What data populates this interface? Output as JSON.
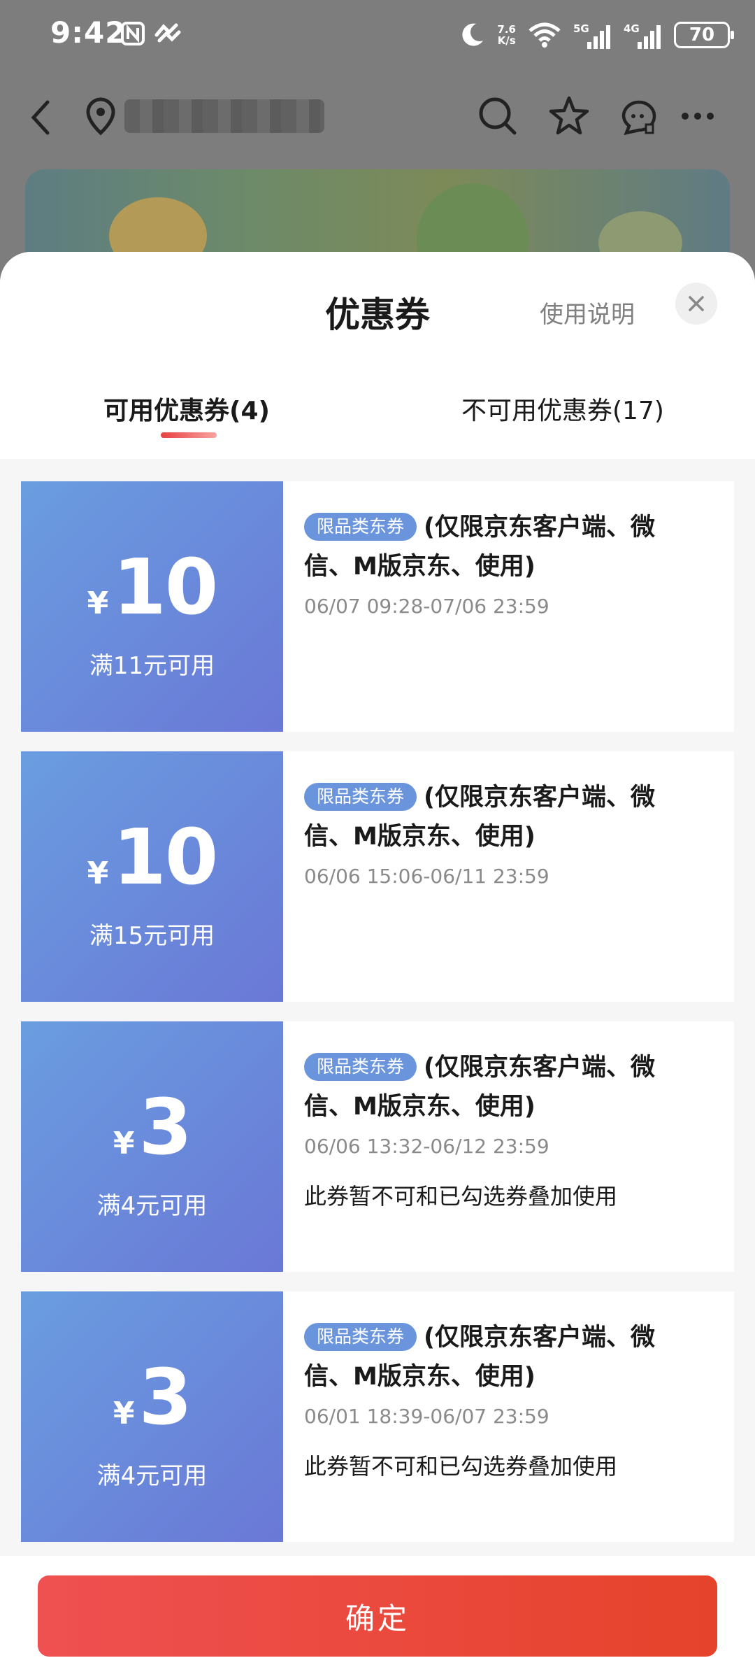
{
  "status_bar": {
    "time": "9:42",
    "net_speed_value": "7.6",
    "net_speed_unit": "K/s",
    "wifi_sub": "6",
    "signal_1": "5G",
    "signal_2": "4G",
    "battery": "70"
  },
  "sheet": {
    "title": "优惠券",
    "help_link": "使用说明",
    "tabs": [
      {
        "label": "可用优惠券(4)",
        "active": true
      },
      {
        "label": "不可用优惠券(17)",
        "active": false
      }
    ],
    "coupons": [
      {
        "currency": "¥",
        "amount": "10",
        "condition": "满11元可用",
        "tag": "限品类东券",
        "description": "(仅限京东客户端、微信、M版京东、使用)",
        "validity": "06/07 09:28-07/06 23:59",
        "note": "",
        "selected": true
      },
      {
        "currency": "¥",
        "amount": "10",
        "condition": "满15元可用",
        "tag": "限品类东券",
        "description": "(仅限京东客户端、微信、M版京东、使用)",
        "validity": "06/06 15:06-06/11 23:59",
        "note": "",
        "selected": true
      },
      {
        "currency": "¥",
        "amount": "3",
        "condition": "满4元可用",
        "tag": "限品类东券",
        "description": "(仅限京东客户端、微信、M版京东、使用)",
        "validity": "06/06 13:32-06/12 23:59",
        "note": "此券暂不可和已勾选券叠加使用",
        "selected": false
      },
      {
        "currency": "¥",
        "amount": "3",
        "condition": "满4元可用",
        "tag": "限品类东券",
        "description": "(仅限京东客户端、微信、M版京东、使用)",
        "validity": "06/01 18:39-06/07 23:59",
        "note": "此券暂不可和已勾选券叠加使用",
        "selected": false
      }
    ],
    "confirm_label": "确定"
  },
  "colors": {
    "accent_red": "#e84638",
    "coupon_blue_start": "#6a9de0",
    "coupon_blue_end": "#6a78d6",
    "tag_blue": "#6a95dd"
  }
}
